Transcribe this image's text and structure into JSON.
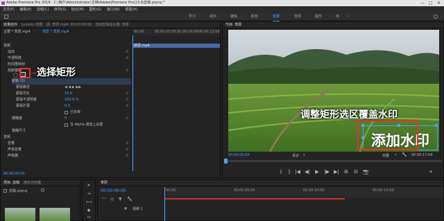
{
  "titlebar": {
    "title": "Adobe Premiere Pro 2019 - C:\\用户\\Administrator\\文档\\Adobe\\Premiere Pro\\13.0\\剪辑.prproj *"
  },
  "menu": [
    "文件(F)",
    "编辑(E)",
    "剪辑(C)",
    "序列(S)",
    "标记(M)",
    "图形(G)",
    "窗口(W)",
    "帮助(H)"
  ],
  "workspace": {
    "items": [
      "学习",
      "组件",
      "编辑",
      "颜色",
      "效果",
      "音频",
      "图形",
      "库"
    ],
    "active_index": 4
  },
  "effect_controls": {
    "tabs": [
      "效果控件",
      "Lumetri 范围",
      "源: 草原.mp4: 00:00:00:00",
      "音频剪辑混合器: 草原"
    ],
    "clip_header": "主要 * 草原.mp4",
    "sequence_header": "草原 * 草原.mp4",
    "timecodes": [
      "00:00",
      "00:00:05:00",
      "00:00:10:00",
      "00:00:15:00"
    ],
    "clip_bar_label": "草原.mp4",
    "rows": [
      {
        "label": "视频",
        "indent": 0
      },
      {
        "label": "运动",
        "indent": 1
      },
      {
        "label": "不透明度",
        "indent": 1
      },
      {
        "label": "时间重映射",
        "indent": 1
      },
      {
        "label": "高斯模糊",
        "indent": 1
      },
      {
        "label": "蒙版 (1)",
        "indent": 2
      },
      {
        "label": "蒙版路径",
        "indent": 3
      },
      {
        "label": "蒙版羽化",
        "indent": 3,
        "value": "10.0"
      },
      {
        "label": "蒙版不透明度",
        "indent": 3,
        "value": "100.0 %"
      },
      {
        "label": "蒙版扩展",
        "indent": 3,
        "value": "0.0"
      },
      {
        "label": "已反转",
        "indent": 3
      },
      {
        "label": "模糊度",
        "indent": 2,
        "value": "0"
      },
      {
        "label": "模糊尺寸",
        "indent": 2,
        "value": "在 Alpha 通道上设置"
      },
      {
        "label": "音频",
        "indent": 0
      },
      {
        "label": "音量",
        "indent": 1
      },
      {
        "label": "声道音量",
        "indent": 1
      },
      {
        "label": "声像器",
        "indent": 1
      }
    ],
    "bottom_timecode": "00:00:00:00",
    "mask_tools": [
      "◯",
      "▢",
      "✎"
    ]
  },
  "program_monitor": {
    "tab": "节目: 草原",
    "timecode_left": "00:00:00:00",
    "fit_label": "适合",
    "full_label": "完整",
    "timecode_right": "00:00:17:04",
    "watermark_text": "添加水印",
    "controls": [
      "{",
      "}",
      "|◀",
      "◀|",
      "▶",
      "|▶",
      "▶|",
      "⊞",
      "⊟",
      "📷",
      "+"
    ]
  },
  "project": {
    "tabs": [
      "项目: 剪辑",
      "媒体浏览器"
    ],
    "file_label": "剪辑.prproj",
    "thumbs": 2
  },
  "timeline": {
    "tab": "草原",
    "timecode": "00:00:00:00",
    "times": [
      "00:00",
      "00:00:05:00",
      "00:00:10:00",
      "00:00:15:00"
    ],
    "track_label": "视频 1"
  },
  "annotations": {
    "select_rect": "选择矩形",
    "adjust_rect": "调整矩形选区覆盖水印"
  },
  "colors": {
    "accent": "#4ea1ff",
    "annotation_red": "#e8312a"
  }
}
